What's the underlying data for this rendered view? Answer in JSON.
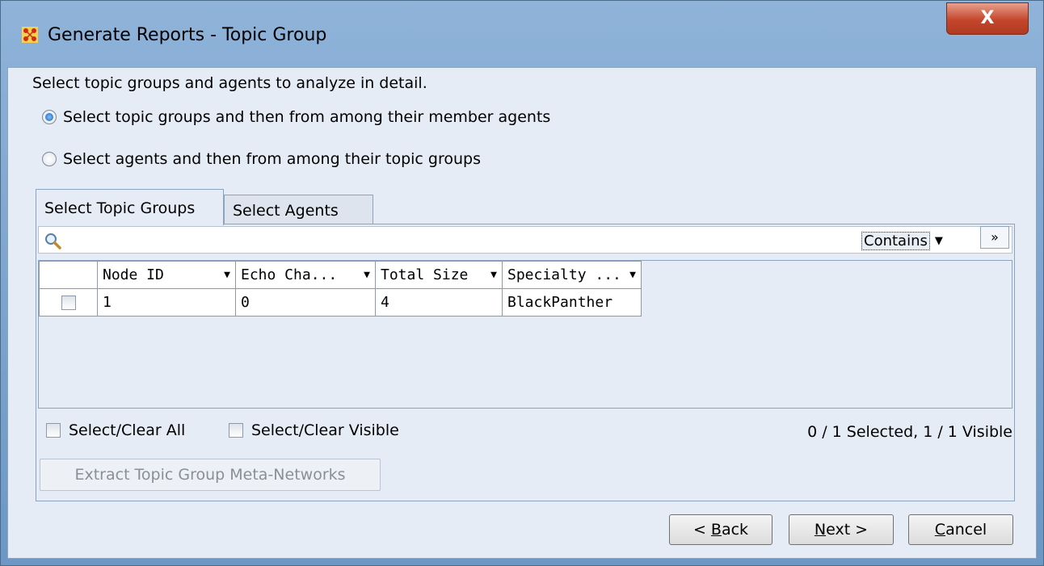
{
  "window": {
    "title": "Generate Reports - Topic Group",
    "close_label": "X"
  },
  "instructions": "Select topic groups and agents to analyze in detail.",
  "mode_options": [
    {
      "label": "Select topic groups and then from among their member agents",
      "selected": true
    },
    {
      "label": "Select agents and then from among their topic groups",
      "selected": false
    }
  ],
  "tabs": [
    {
      "label": "Select Topic Groups",
      "active": true
    },
    {
      "label": "Select Agents",
      "active": false
    }
  ],
  "search": {
    "value": "",
    "match_mode": "Contains",
    "expand_icon": "double-chevron-down-icon"
  },
  "table": {
    "columns": [
      "Node ID",
      "Echo Cha...",
      "Total Size",
      "Specialty ..."
    ],
    "rows": [
      {
        "checked": false,
        "cells": [
          "1",
          "0",
          "4",
          "BlackPanther"
        ]
      }
    ]
  },
  "select_clear_all": "Select/Clear All",
  "select_clear_visible": "Select/Clear Visible",
  "status": "0 / 1 Selected, 1 / 1 Visible",
  "extract_button": "Extract Topic Group Meta-Networks",
  "buttons": {
    "back": {
      "prefix": "< ",
      "mnemonic": "B",
      "rest": "ack"
    },
    "next": {
      "prefix": "",
      "mnemonic": "N",
      "rest": "ext >"
    },
    "cancel": {
      "prefix": "",
      "mnemonic": "C",
      "rest": "ancel"
    }
  },
  "colors": {
    "title_bar": "#6d97c4",
    "close_button": "#c4462b",
    "client_bg": "#e5ecf5"
  }
}
